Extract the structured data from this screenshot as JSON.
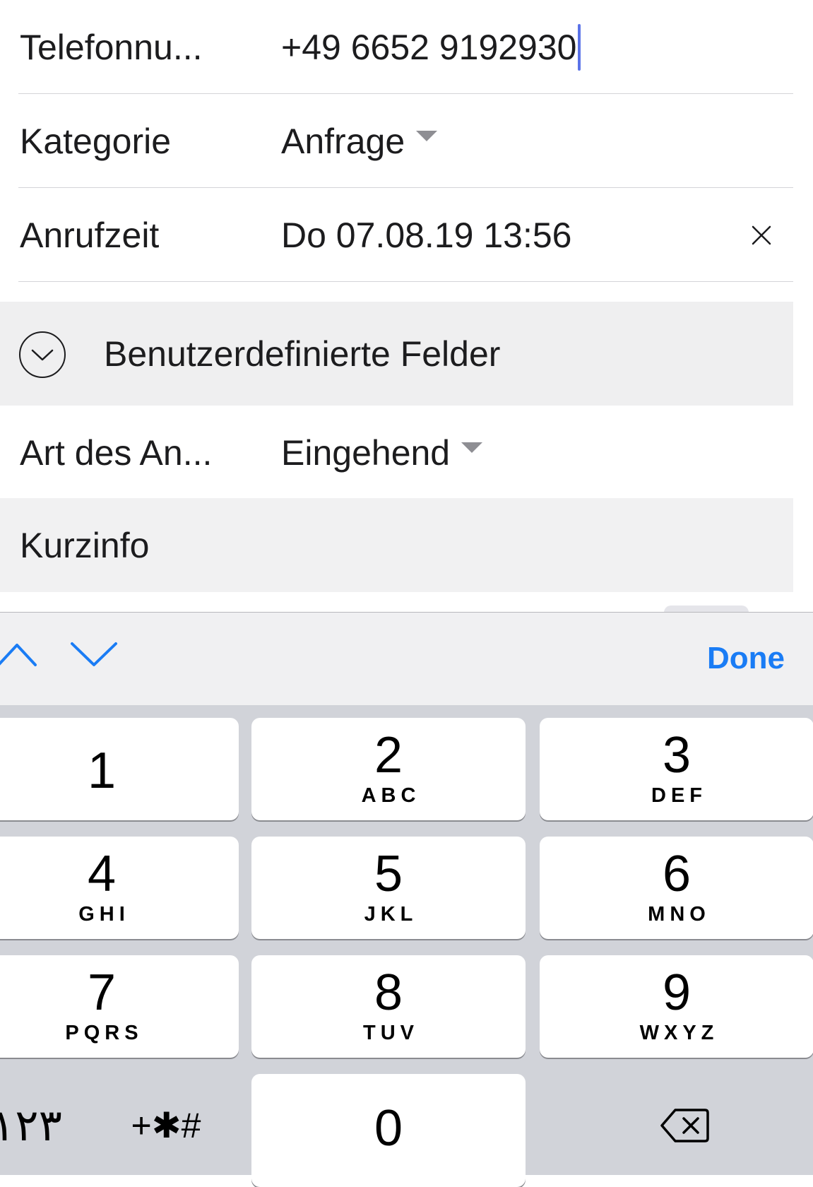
{
  "form": {
    "phone": {
      "label": "Telefonnu...",
      "value": "+49 6652 9192930"
    },
    "category": {
      "label": "Kategorie",
      "value": "Anfrage"
    },
    "call_time": {
      "label": "Anrufzeit",
      "value": "Do 07.08.19 13:56"
    },
    "custom_fields_section": {
      "title": "Benutzerdefinierte Felder"
    },
    "call_type": {
      "label": "Art des An...",
      "value": "Eingehend"
    },
    "short_info": {
      "label": "Kurzinfo"
    }
  },
  "toolbar": {
    "prev_icon": "chevron-up-icon",
    "next_icon": "chevron-down-icon",
    "done_label": "Done",
    "accent_color": "#1a7cf5"
  },
  "keypad": {
    "keys": [
      {
        "num": "1",
        "letters": ""
      },
      {
        "num": "2",
        "letters": "ABC"
      },
      {
        "num": "3",
        "letters": "DEF"
      },
      {
        "num": "4",
        "letters": "GHI"
      },
      {
        "num": "5",
        "letters": "JKL"
      },
      {
        "num": "6",
        "letters": "MNO"
      },
      {
        "num": "7",
        "letters": "PQRS"
      },
      {
        "num": "8",
        "letters": "TUV"
      },
      {
        "num": "9",
        "letters": "WXYZ"
      },
      {
        "num": "0",
        "letters": ""
      }
    ],
    "arabic_label": "١٢٣",
    "symbols_label": "+✱#",
    "delete_icon": "backspace-icon"
  }
}
